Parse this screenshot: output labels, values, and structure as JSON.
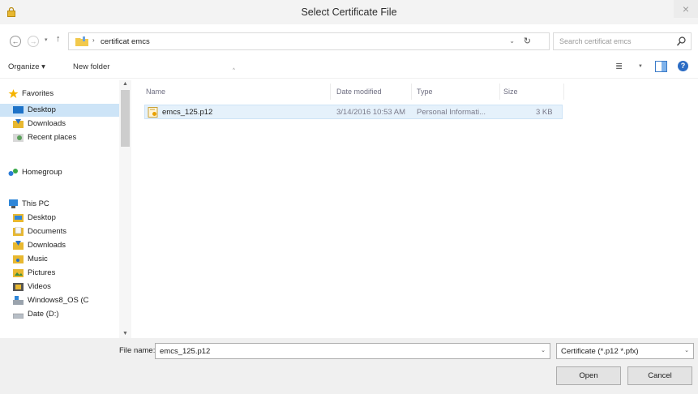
{
  "window": {
    "title": "Select Certificate File",
    "close_glyph": "×"
  },
  "nav_buttons": {
    "back": "←",
    "forward": "→",
    "recent": "▾",
    "up": "↑"
  },
  "address": {
    "separator": "›",
    "path": "certificat emcs",
    "dropdown": "⌄",
    "refresh": "↻"
  },
  "search": {
    "placeholder": "Search certificat emcs"
  },
  "toolbar": {
    "organize": "Organize ▾",
    "new_folder": "New folder",
    "view": "≣",
    "view_dropdown": "▼",
    "help": "?"
  },
  "sidebar": {
    "favorites": [
      {
        "label": "Favorites",
        "icon": "star-icon"
      },
      {
        "label": "Desktop",
        "icon": "desktop-icon",
        "selected": true
      },
      {
        "label": "Downloads",
        "icon": "downloads-icon"
      },
      {
        "label": "Recent places",
        "icon": "recent-places-icon"
      }
    ],
    "homegroup": {
      "label": "Homegroup",
      "icon": "homegroup-icon"
    },
    "this_pc": [
      {
        "label": "This PC",
        "icon": "computer-icon"
      },
      {
        "label": "Desktop",
        "icon": "desktop-folder-icon"
      },
      {
        "label": "Documents",
        "icon": "documents-icon"
      },
      {
        "label": "Downloads",
        "icon": "downloads-icon"
      },
      {
        "label": "Music",
        "icon": "music-icon"
      },
      {
        "label": "Pictures",
        "icon": "pictures-icon"
      },
      {
        "label": "Videos",
        "icon": "videos-icon"
      },
      {
        "label": "Windows8_OS (C",
        "icon": "drive-icon"
      },
      {
        "label": "Date (D:)",
        "icon": "drive-icon"
      }
    ],
    "scroll_up": "▲",
    "scroll_down": "▼"
  },
  "file_list": {
    "columns": {
      "name": "Name",
      "date_modified": "Date modified",
      "type": "Type",
      "size": "Size"
    },
    "sort_indicator": "^",
    "files": [
      {
        "name": "emcs_125.p12",
        "date_modified": "3/14/2016 10:53 AM",
        "type": "Personal Informati...",
        "size": "3 KB"
      }
    ]
  },
  "bottom": {
    "file_name_label": "File name:",
    "file_name_value": "emcs_125.p12",
    "dropdown_glyph": "⌄",
    "filter_value": "Certificate (*.p12 *.pfx)",
    "open_label": "Open",
    "cancel_label": "Cancel"
  },
  "colors": {
    "selection": "#cde4f7",
    "file_highlight": "#e5f1fb",
    "accent": "#2b6cc4",
    "folder": "#f2c94c"
  }
}
